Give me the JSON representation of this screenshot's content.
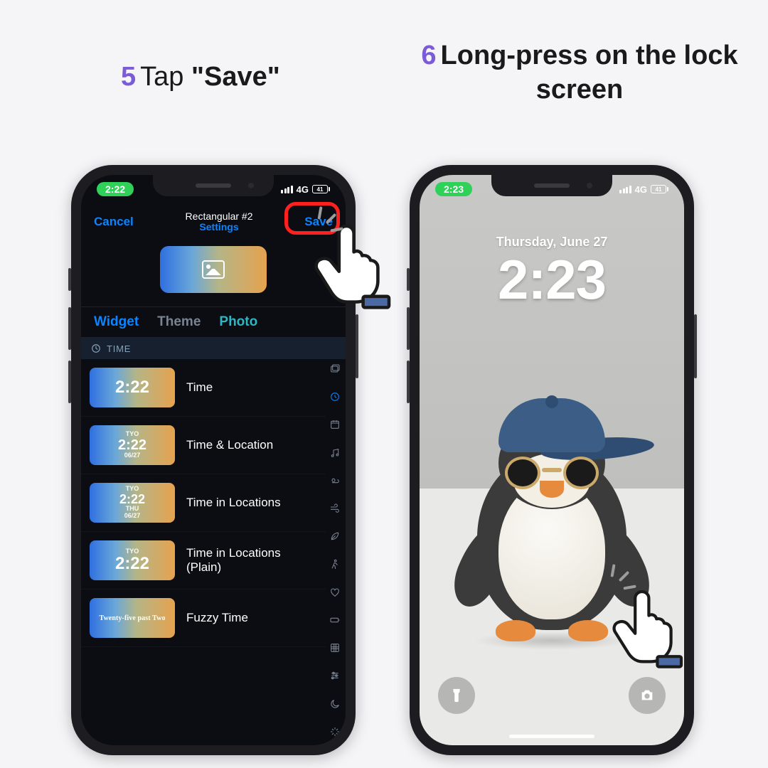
{
  "steps": {
    "s5": {
      "num": "5",
      "pre": "Tap ",
      "bold": "\"Save\""
    },
    "s6": {
      "num": "6",
      "text": "Long-press on the lock screen"
    }
  },
  "phoneA": {
    "status": {
      "time": "2:22",
      "net": "4G",
      "battery": "41"
    },
    "header": {
      "cancel": "Cancel",
      "title": "Rectangular #2",
      "subtitle": "Settings",
      "save": "Save"
    },
    "tabs": {
      "widget": "Widget",
      "theme": "Theme",
      "photo": "Photo"
    },
    "section": "TIME",
    "rows": [
      {
        "label": "Time",
        "thumb_big": "2:22"
      },
      {
        "label": "Time & Location",
        "thumb_top": "TYO",
        "thumb_big": "2:22",
        "thumb_bot": "06/27"
      },
      {
        "label": "Time in Locations",
        "thumb_top": "TYO",
        "thumb_big": "2:22",
        "thumb_bot": "THU\n06/27"
      },
      {
        "label": "Time in Locations (Plain)",
        "thumb_top": "TYO",
        "thumb_big": "2:22"
      },
      {
        "label": "Fuzzy Time",
        "thumb_text": "Twenty-five past Two"
      }
    ],
    "rail": [
      "photos",
      "clock",
      "calendar",
      "music",
      "weather",
      "wind",
      "leaf",
      "walk",
      "heart",
      "battery",
      "grid",
      "sliders",
      "moon",
      "sparkle"
    ]
  },
  "phoneB": {
    "status": {
      "time": "2:23",
      "net": "4G",
      "battery": "41"
    },
    "lock": {
      "date": "Thursday, June 27",
      "time": "2:23"
    }
  }
}
